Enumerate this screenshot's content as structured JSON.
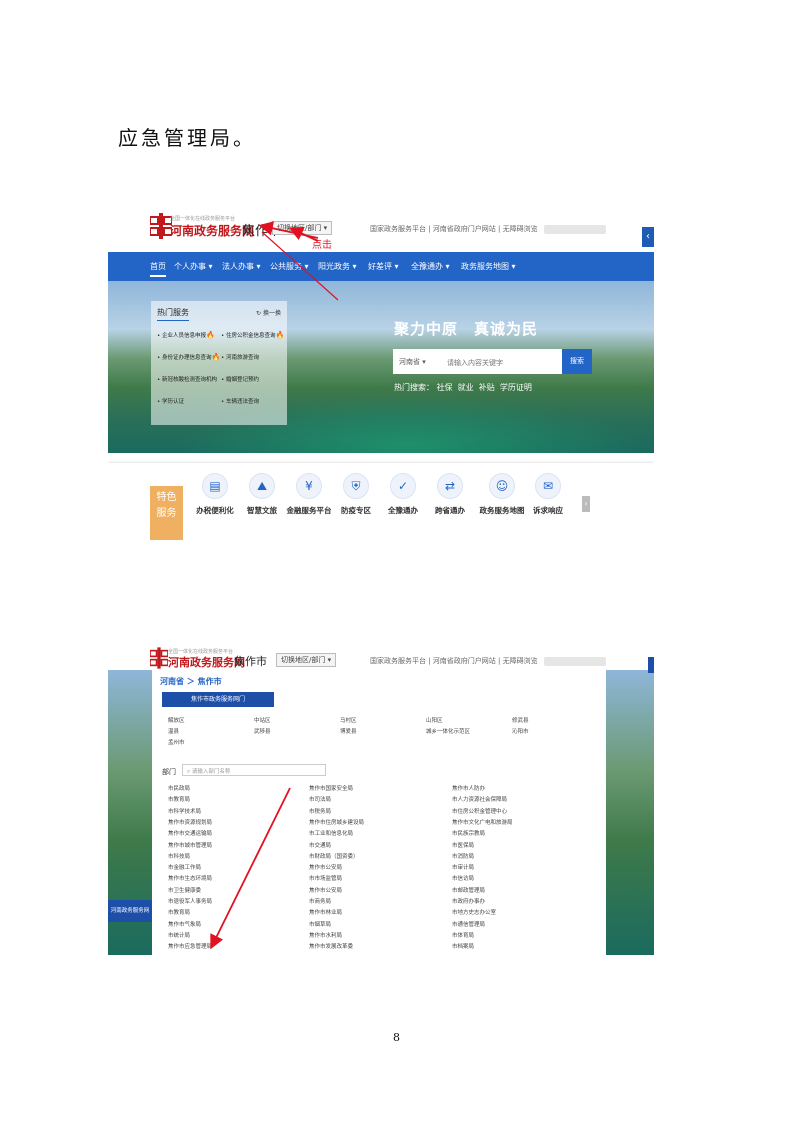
{
  "intro_text": "应急管理局。",
  "page_number": "8",
  "colors": {
    "nav_blue": "#2364c7",
    "brand_red": "#c0181c",
    "annotation_red": "#e11122",
    "feature_orange": "#f0b061"
  },
  "header": {
    "brand_tagline": "全国一体化在线政务服务平台",
    "brand_name": "河南政务服务网",
    "city": "焦作市",
    "switch_label": "切换地区/部门",
    "top_links": [
      "国家政务服务平台",
      "河南省政府门户网站",
      "无障碍浏览"
    ]
  },
  "annotation": {
    "click_note": "点击"
  },
  "nav": {
    "items": [
      "首页",
      "个人办事",
      "法人办事",
      "公共服务",
      "阳光政务",
      "好差评",
      "全豫通办",
      "政务服务地图"
    ]
  },
  "hot_services": {
    "title": "热门服务",
    "refresh": "换一换",
    "items": [
      "企业人员信息申报",
      "住房公积金信息查询",
      "身份证办理信息查询",
      "河南旅游查询",
      "新冠核酸检测查询机构",
      "婚姻登记预约",
      "学历认证",
      "车辆违法查询"
    ]
  },
  "banner": {
    "slogan": "聚力中原　真诚为民",
    "search_scope": "河南省",
    "search_placeholder": "请输入内容关键字",
    "search_button": "搜索",
    "hot_search_label": "热门搜索：",
    "hot_search_terms": [
      "社保",
      "就业",
      "补贴",
      "学历证明"
    ]
  },
  "features": {
    "label": "特色服务",
    "items": [
      {
        "label": "办税便利化",
        "icon": "document-icon"
      },
      {
        "label": "智慧文旅",
        "icon": "mountain-icon"
      },
      {
        "label": "金融服务平台",
        "icon": "finance-icon"
      },
      {
        "label": "防疫专区",
        "icon": "shield-icon"
      },
      {
        "label": "全豫通办",
        "icon": "check-circle-icon"
      },
      {
        "label": "跨省通办",
        "icon": "transfer-icon"
      },
      {
        "label": "政务服务地图",
        "icon": "person-icon"
      },
      {
        "label": "诉求响应",
        "icon": "chat-icon"
      }
    ]
  },
  "region_panel": {
    "breadcrumb": "河南省 ＞ 焦作市",
    "city_portal_button": "焦作市政务服务网门",
    "areas": [
      "解放区",
      "中站区",
      "马村区",
      "山阳区",
      "修武县",
      "温县",
      "武陟县",
      "博爱县",
      "城乡一体化示范区",
      "沁阳市",
      "孟州市"
    ],
    "dept_label": "部门",
    "dept_search_placeholder": "请输入部门名称",
    "departments_col1": [
      "市民政局",
      "市教育局",
      "市科学技术局",
      "焦作市资源规划局",
      "焦作市交通运输局",
      "焦作市城市管理局",
      "市科技局",
      "市金融工作局",
      "焦作市生态环境局",
      "市卫生健康委",
      "市退役军人事务局",
      "市教育局",
      "焦作市气象局",
      "市统计局",
      "焦作市应急管理局"
    ],
    "departments_col2": [
      "焦作市国家安全局",
      "市司法局",
      "市税务局",
      "焦作市住房城乡建设局",
      "市工业和信息化局",
      "市交通局",
      "市财政局（国资委）",
      "焦作市公安局",
      "市市场监管局",
      "焦作市公安局",
      "市商务局",
      "焦作市林业局",
      "市烟草局",
      "焦作市水利局",
      "焦作市发展改革委",
      "焦作市新型城镇化局"
    ],
    "departments_col3": [
      "焦作市人防办",
      "市人力资源社会保障局",
      "市住房公积金管理中心",
      "焦作市文化广电和旅游局",
      "市民族宗教局",
      "市医保局",
      "市消防局",
      "市审计局",
      "市信访局",
      "市邮政管理局",
      "市政府办事办",
      "市地方史志办公室",
      "市通信管理局",
      "市体育局",
      "市档案局",
      "市无线电管理局"
    ],
    "left_stub": "河南政务服务网"
  }
}
